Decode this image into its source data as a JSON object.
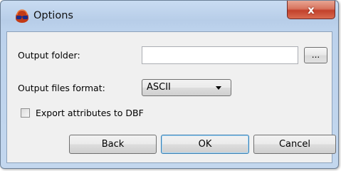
{
  "window": {
    "title": "Options",
    "close_glyph": "x",
    "icon": "red-glasses-app-icon"
  },
  "form": {
    "output_folder_label": "Output folder:",
    "output_folder_value": "",
    "browse_label": "...",
    "format_label": "Output files format:",
    "format_value": "ASCII",
    "export_label": "Export attributes to DBF",
    "export_checked": false
  },
  "buttons": {
    "back": "Back",
    "ok": "OK",
    "cancel": "Cancel"
  },
  "colors": {
    "title_bar": "#bcd2ec",
    "close_button": "#c2412c",
    "client_background": "#f0f0f0",
    "default_button_border": "#3c7fb1"
  }
}
